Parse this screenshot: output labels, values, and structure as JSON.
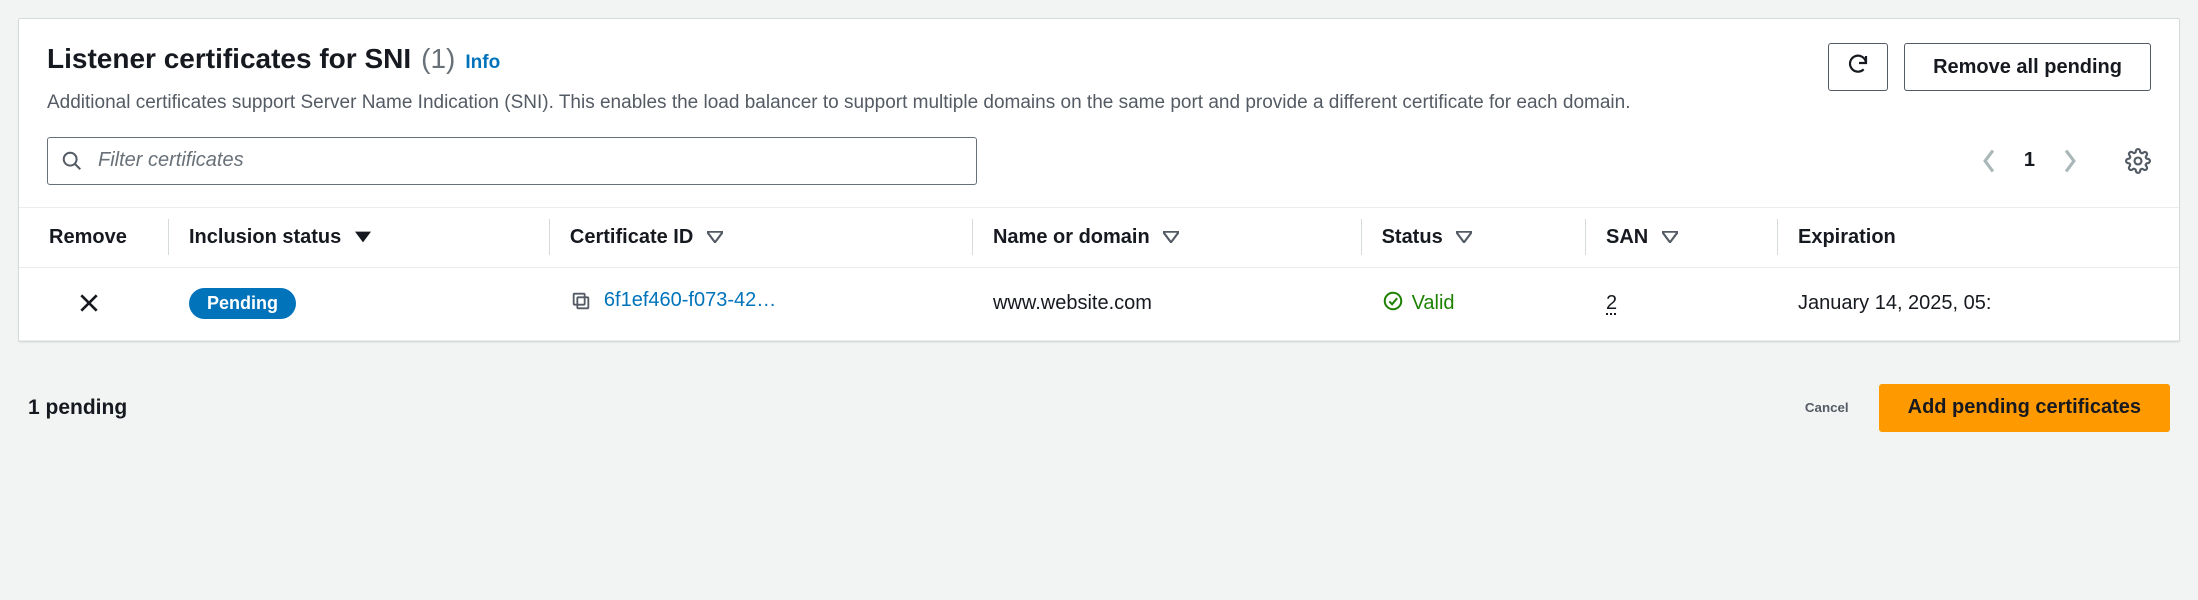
{
  "header": {
    "title": "Listener certificates for SNI",
    "count": "(1)",
    "info_label": "Info",
    "description": "Additional certificates support Server Name Indication (SNI). This enables the load balancer to support multiple domains on the same port and provide a different certificate for each domain.",
    "refresh_label": "Refresh",
    "remove_all_label": "Remove all pending"
  },
  "search": {
    "placeholder": "Filter certificates"
  },
  "pagination": {
    "page": "1"
  },
  "table": {
    "columns": {
      "remove": "Remove",
      "inclusion_status": "Inclusion status",
      "certificate_id": "Certificate ID",
      "name_or_domain": "Name or domain",
      "status": "Status",
      "san": "SAN",
      "expiration": "Expiration"
    },
    "rows": [
      {
        "inclusion_status": "Pending",
        "certificate_id": "6f1ef460-f073-42…",
        "name_or_domain": "www.website.com",
        "status": "Valid",
        "san": "2",
        "expiration": "January 14, 2025, 05:"
      }
    ]
  },
  "footer": {
    "pending_text": "1 pending",
    "cancel_label": "Cancel",
    "add_label": "Add pending certificates"
  }
}
